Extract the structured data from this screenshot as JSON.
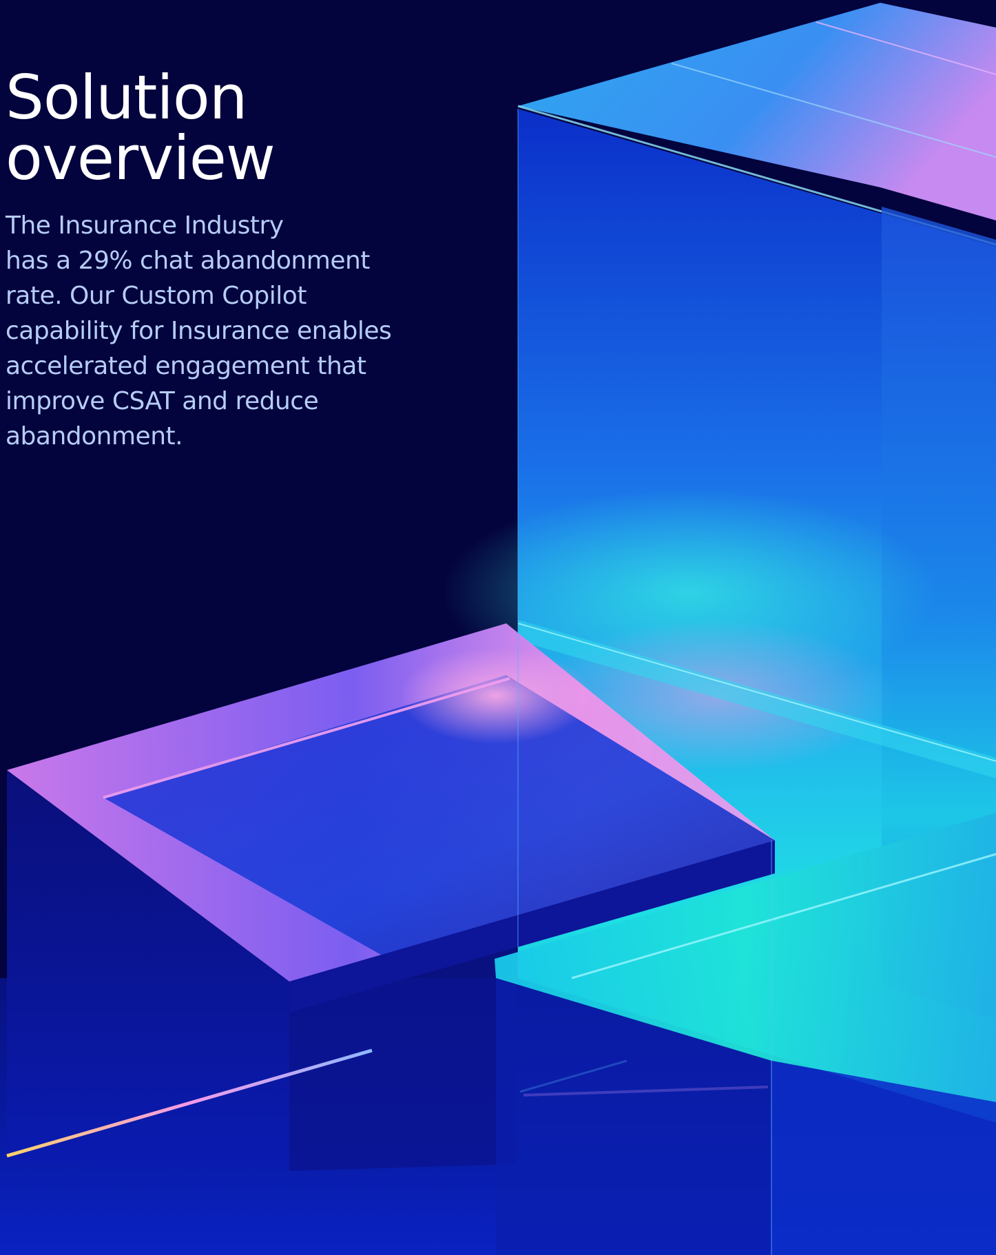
{
  "hero": {
    "title_lines": [
      "Solution",
      "overview"
    ],
    "body_lines": [
      "The Insurance Industry",
      "has a 29% chat abandonment",
      "rate. Our Custom Copilot",
      "capability for Insurance enables",
      "accelerated engagement that",
      "improve CSAT and reduce",
      "abandonment."
    ]
  },
  "colors": {
    "background": "#03033d",
    "title": "#ffffff",
    "body": "#b6cdf6",
    "accent_cyan": "#1ed9e8",
    "accent_blue": "#1a73f0",
    "accent_pink": "#e58af0"
  },
  "decoration": {
    "name": "glass-blocks-illustration"
  }
}
